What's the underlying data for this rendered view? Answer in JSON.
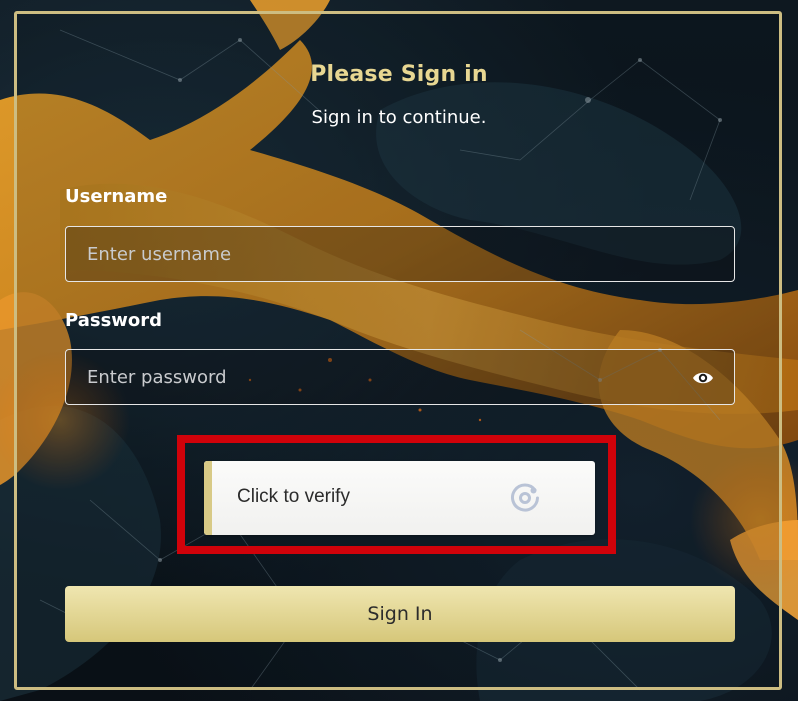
{
  "header": {
    "title": "Please Sign in",
    "subtitle": "Sign in to continue."
  },
  "form": {
    "username_label": "Username",
    "username_placeholder": "Enter username",
    "username_value": "",
    "password_label": "Password",
    "password_placeholder": "Enter password",
    "password_value": ""
  },
  "captcha": {
    "label": "Click to verify"
  },
  "actions": {
    "signin_label": "Sign In"
  },
  "icons": {
    "password_toggle": "eye-icon",
    "captcha": "captcha-refresh-icon"
  },
  "colors": {
    "accent_gold": "#e8d792",
    "frame_border": "#cdbd82",
    "highlight_red": "#d0020a",
    "button_gradient_top": "#efe6b0",
    "button_gradient_bottom": "#d6c77a"
  }
}
